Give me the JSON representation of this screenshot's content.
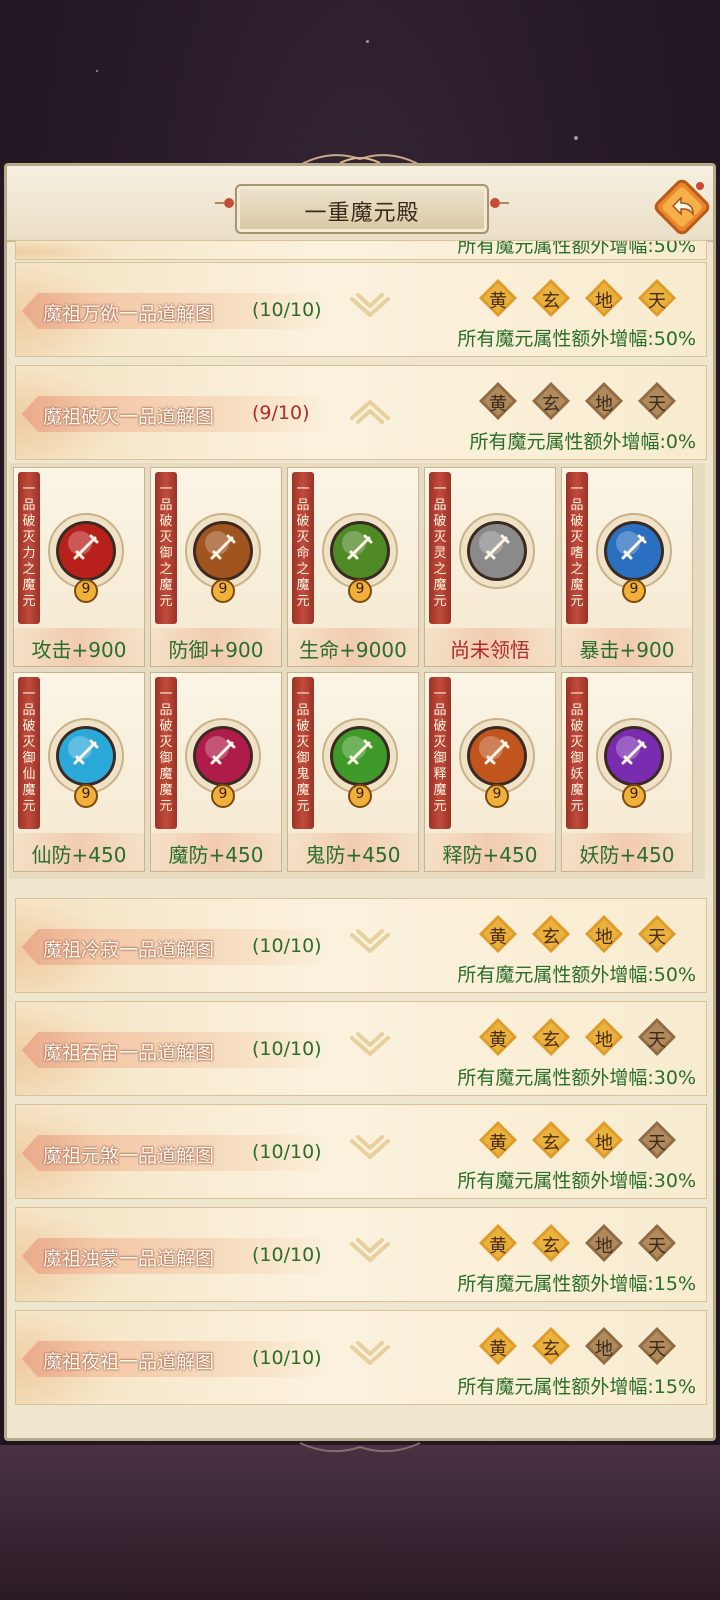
{
  "title": "一重魔元殿",
  "back_icon": "back-arrow-icon",
  "partial_row_bonus": "所有魔元属性额外增幅:50%",
  "grades": [
    "黄",
    "玄",
    "地",
    "天"
  ],
  "rows": [
    {
      "name": "魔祖万欲一品道解图",
      "progress": "(10/10)",
      "bonus": "所有魔元属性额外增幅:50%",
      "grades_lit": [
        true,
        true,
        true,
        true
      ],
      "expanded": false
    },
    {
      "name": "魔祖破灭一品道解图",
      "progress": "(9/10)",
      "bonus": "所有魔元属性额外增幅:0%",
      "grades_lit": [
        false,
        false,
        false,
        false
      ],
      "expanded": true
    },
    {
      "name": "魔祖冷寂一品道解图",
      "progress": "(10/10)",
      "bonus": "所有魔元属性额外增幅:50%",
      "grades_lit": [
        true,
        true,
        true,
        true
      ],
      "expanded": false
    },
    {
      "name": "魔祖吞宙一品道解图",
      "progress": "(10/10)",
      "bonus": "所有魔元属性额外增幅:30%",
      "grades_lit": [
        true,
        true,
        true,
        false
      ],
      "expanded": false
    },
    {
      "name": "魔祖元煞一品道解图",
      "progress": "(10/10)",
      "bonus": "所有魔元属性额外增幅:30%",
      "grades_lit": [
        true,
        true,
        true,
        false
      ],
      "expanded": false
    },
    {
      "name": "魔祖浊蒙一品道解图",
      "progress": "(10/10)",
      "bonus": "所有魔元属性额外增幅:15%",
      "grades_lit": [
        true,
        true,
        false,
        false
      ],
      "expanded": false
    },
    {
      "name": "魔祖夜祖一品道解图",
      "progress": "(10/10)",
      "bonus": "所有魔元属性额外增幅:15%",
      "grades_lit": [
        true,
        true,
        false,
        false
      ],
      "expanded": false
    }
  ],
  "cards": [
    {
      "tag": "一品破灭力之魔元",
      "stat": "攻击+900",
      "level": "9",
      "color": "#b8201c",
      "icon": "sword-icon",
      "locked": false
    },
    {
      "tag": "一品破灭御之魔元",
      "stat": "防御+900",
      "level": "9",
      "color": "#a0551e",
      "icon": "shield-crest-icon",
      "locked": false
    },
    {
      "tag": "一品破灭命之魔元",
      "stat": "生命+9000",
      "level": "9",
      "color": "#4f8a26",
      "icon": "heart-icon",
      "locked": false
    },
    {
      "tag": "一品破灭灵之魔元",
      "stat": "尚未领悟",
      "level": "",
      "color": "#8a8a8a",
      "icon": "claw-icon",
      "locked": true
    },
    {
      "tag": "一品破灭嗜之魔元",
      "stat": "暴击+900",
      "level": "9",
      "color": "#2a6fc0",
      "icon": "burst-icon",
      "locked": false
    },
    {
      "tag": "一品破灭御仙魔元",
      "stat": "仙防+450",
      "level": "9",
      "color": "#2aa8d8",
      "icon": "immortal-seal-icon",
      "locked": false
    },
    {
      "tag": "一品破灭御魔魔元",
      "stat": "魔防+450",
      "level": "9",
      "color": "#b01c4a",
      "icon": "demon-seal-icon",
      "locked": false
    },
    {
      "tag": "一品破灭御鬼魔元",
      "stat": "鬼防+450",
      "level": "9",
      "color": "#3f9a2a",
      "icon": "ghost-seal-icon",
      "locked": false
    },
    {
      "tag": "一品破灭御释魔元",
      "stat": "释防+450",
      "level": "9",
      "color": "#c0561e",
      "icon": "buddha-seal-icon",
      "locked": false
    },
    {
      "tag": "一品破灭御妖魔元",
      "stat": "妖防+450",
      "level": "9",
      "color": "#7a2cb0",
      "icon": "beast-seal-icon",
      "locked": false
    }
  ],
  "colors": {
    "lit_gem": "#e9b23c",
    "dim_gem": "#b08a5a",
    "progress_ok": "#2a6e2a",
    "progress_warn": "#b02a2a"
  }
}
